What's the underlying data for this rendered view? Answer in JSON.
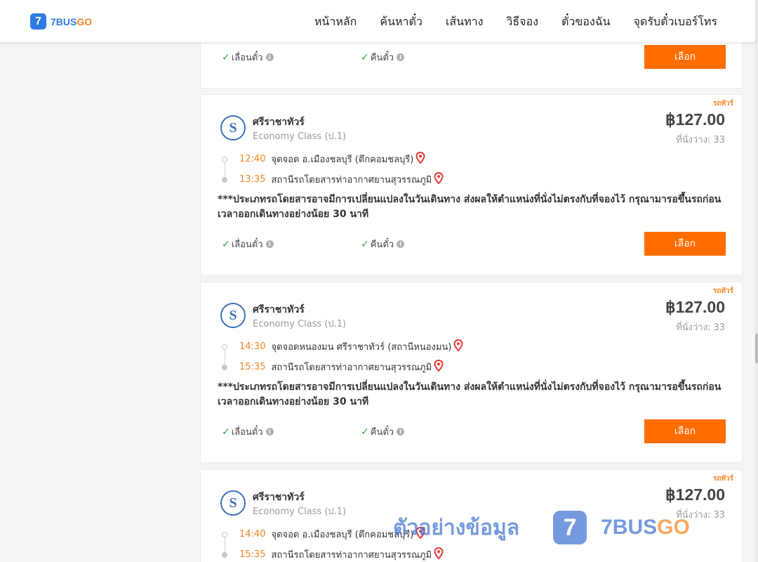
{
  "header": {
    "logo_digit": "7",
    "logo_bus": "BUS",
    "logo_go": "GO",
    "nav": [
      "หน้าหลัก",
      "ค้นหาตั๋ว",
      "เส้นทาง",
      "วิธีจอง",
      "ตั๋วของฉัน",
      "จุดรับตั๋วเบอร์โทร"
    ]
  },
  "common": {
    "reschedule_label": "เลื่อนตั๋ว",
    "refund_label": "คืนตั๋ว",
    "select_label": "เลือก",
    "tag": "รถทัวร์",
    "seats_prefix": "ที่นั่งว่าง: ",
    "note": "***ประเภทรถโดยสารอาจมีการเปลี่ยนแปลงในวันเดินทาง ส่งผลให้ตำแหน่งที่นั่งไม่ตรงกับที่จองไว้ กรุณามารอขึ้นรถก่อนเวลาออกเดินทางอย่างน้อย 30 นาที"
  },
  "trips": [
    {
      "operator": "ศรีราชาทัวร์",
      "class": "Economy Class (ป.1)",
      "price": "฿127.00",
      "seats": "ที่นั่งว่าง: 33",
      "depart_time": "12:40",
      "depart_place": "จุดจอด อ.เมืองชลบุรี (ตึกคอมชลบุรี)",
      "arrive_time": "13:35",
      "arrive_place": "สถานีรถโดยสารท่าอากาศยานสุวรรณภูมิ"
    },
    {
      "operator": "ศรีราชาทัวร์",
      "class": "Economy Class (ป.1)",
      "price": "฿127.00",
      "seats": "ที่นั่งว่าง: 33",
      "depart_time": "14:30",
      "depart_place": "จุดจอดหนองมน ศรีราชาทัวร์ (สถานีหนองมน)",
      "arrive_time": "15:35",
      "arrive_place": "สถานีรถโดยสารท่าอากาศยานสุวรรณภูมิ"
    },
    {
      "operator": "ศรีราชาทัวร์",
      "class": "Economy Class (ป.1)",
      "price": "฿127.00",
      "seats": "ที่นั่งว่าง: 33",
      "depart_time": "14:40",
      "depart_place": "จุดจอด อ.เมืองชลบุรี (ตึกคอมชลบุรี)",
      "arrive_time": "15:35",
      "arrive_place": "สถานีรถโดยสารท่าอากาศยานสุวรรณภูมิ"
    }
  ],
  "watermark": {
    "text": "ตัวอย่างข้อมูล",
    "badge": "7",
    "brand_bus": "7BUS",
    "brand_go": "GO"
  },
  "colors": {
    "accent": "#ff6d00",
    "brand_blue": "#2d7be5",
    "brand_orange": "#f5841f",
    "check_green": "#2e9e44"
  }
}
